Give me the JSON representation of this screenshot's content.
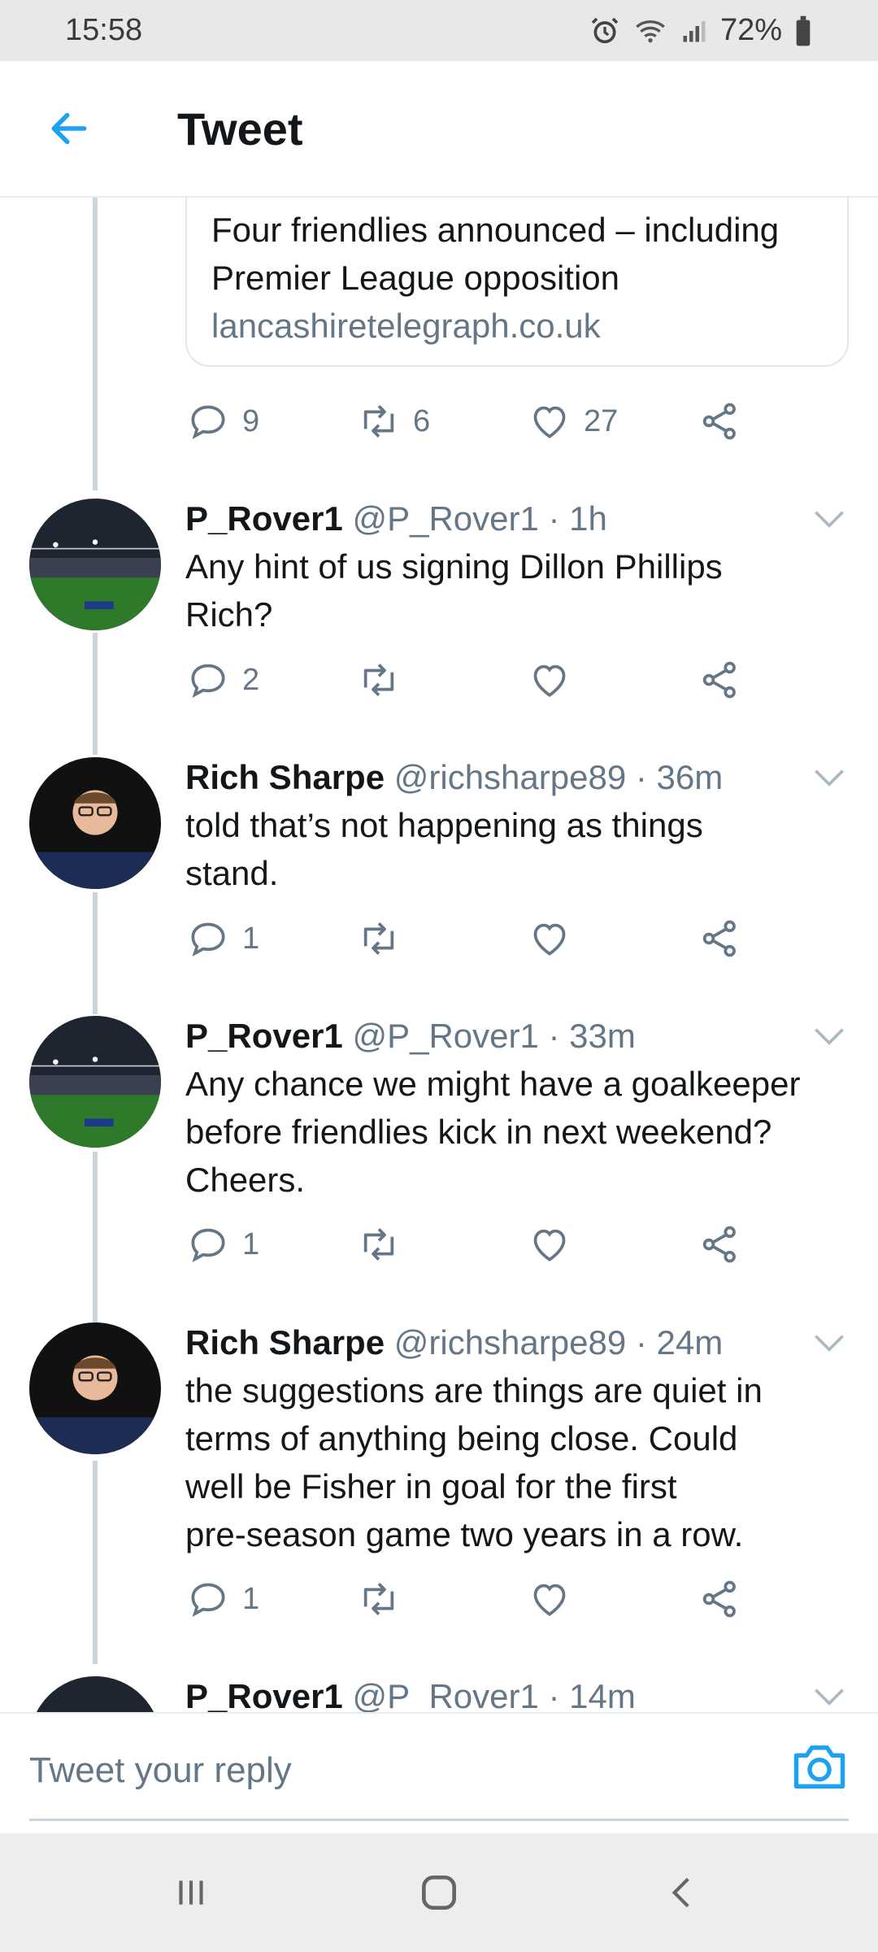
{
  "status_bar": {
    "time": "15:58",
    "battery": "72%"
  },
  "header": {
    "title": "Tweet"
  },
  "link_card": {
    "title_line1": "Four friendlies announced – including",
    "title_line2": "Premier League opposition",
    "domain": "lancashiretelegraph.co.uk",
    "actions": {
      "replies": "9",
      "retweets": "6",
      "likes": "27"
    }
  },
  "tweets": [
    {
      "name": "P_Rover1",
      "meta": "@P_Rover1 · 1h",
      "lines": [
        "Any hint of us signing Dillon Phillips",
        "Rich?"
      ],
      "replies": "2"
    },
    {
      "name": "Rich Sharpe",
      "meta": "@richsharpe89 · 36m",
      "lines": [
        "told that’s not happening as things",
        "stand."
      ],
      "replies": "1"
    },
    {
      "name": "P_Rover1",
      "meta": "@P_Rover1 · 33m",
      "lines": [
        "Any chance we might have a goalkeeper",
        "before friendlies kick in next weekend?",
        "Cheers."
      ],
      "replies": "1"
    },
    {
      "name": "Rich Sharpe",
      "meta": "@richsharpe89 · 24m",
      "lines": [
        "the suggestions are things are quiet in",
        "terms of anything being close. Could",
        "well be Fisher in goal for the first",
        "pre-season game two years in a row."
      ],
      "replies": "1"
    },
    {
      "name": "P_Rover1",
      "meta": "@P_Rover1 · 14m"
    }
  ],
  "reply": {
    "placeholder": "Tweet your reply"
  },
  "colors": {
    "accent": "#1da1f2",
    "text": "#14171a",
    "secondary": "#657786",
    "thread": "#cdd6dd"
  }
}
